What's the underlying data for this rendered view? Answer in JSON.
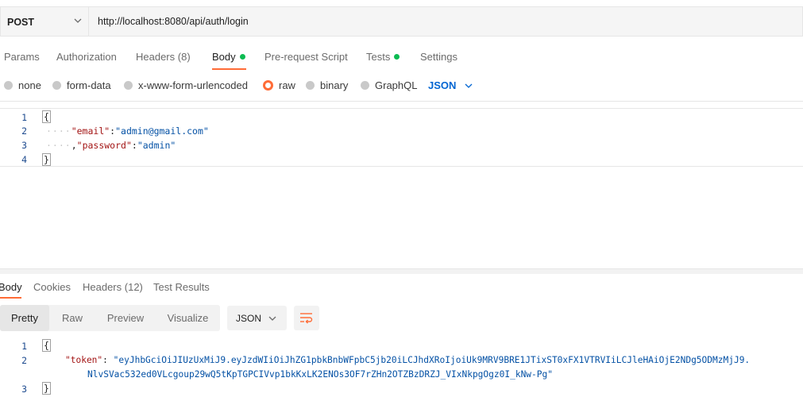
{
  "request": {
    "method": "POST",
    "url": "http://localhost:8080/api/auth/login"
  },
  "request_tabs": [
    {
      "label": "Params"
    },
    {
      "label": "Authorization"
    },
    {
      "label": "Headers",
      "count": "(8)"
    },
    {
      "label": "Body",
      "active": true,
      "dot": true
    },
    {
      "label": "Pre-request Script"
    },
    {
      "label": "Tests",
      "dot": true
    },
    {
      "label": "Settings"
    }
  ],
  "body_types": [
    {
      "label": "none"
    },
    {
      "label": "form-data"
    },
    {
      "label": "x-www-form-urlencoded"
    },
    {
      "label": "raw",
      "selected": true
    },
    {
      "label": "binary"
    },
    {
      "label": "GraphQL"
    }
  ],
  "format_select": "JSON",
  "request_body": {
    "line_numbers": [
      "1",
      "2",
      "3",
      "4"
    ],
    "open_brace": "{",
    "close_brace": "}",
    "email_key": "\"email\"",
    "email_value": "\"admin@gmail.com\"",
    "password_key": "\"password\"",
    "password_value": "\"admin\""
  },
  "response_tabs": [
    {
      "label": "Body",
      "active": true
    },
    {
      "label": "Cookies"
    },
    {
      "label": "Headers",
      "count": "(12)"
    },
    {
      "label": "Test Results"
    }
  ],
  "view_modes": [
    "Pretty",
    "Raw",
    "Preview",
    "Visualize"
  ],
  "response_format": "JSON",
  "response_body": {
    "line_numbers": [
      "1",
      "2",
      "3"
    ],
    "open_brace": "{",
    "close_brace": "}",
    "token_key": "\"token\"",
    "token_value_line1": "\"eyJhbGciOiJIUzUxMiJ9.eyJzdWIiOiJhZG1pbkBnbWFpbC5jb20iLCJhdXRoIjoiUk9MRV9BRE1JTixST0xFX1VTRVIiLCJleHAiOjE2NDg5ODMzMjJ9.",
    "token_value_line2": "NlvSVac532ed0VLcgoup29wQ5tKpTGPCIVvp1bkKxLK2ENOs3OF7rZHn2OTZBzDRZJ_VIxNkpgOgz0I_kNw-Pg\""
  },
  "colors": {
    "accent": "#ff6c37",
    "dot_green": "#0cbb52",
    "json_blue": "#0265d2"
  }
}
